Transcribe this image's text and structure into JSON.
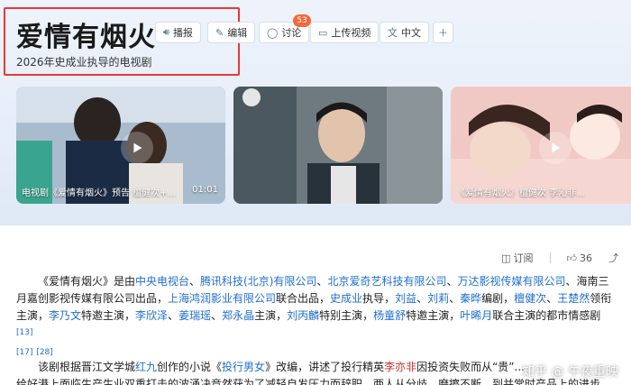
{
  "header": {
    "title": "爱情有烟火",
    "subtitle": "2026年史成业执导的电视剧"
  },
  "actions": {
    "play": "播报",
    "edit": "编辑",
    "discuss": "讨论",
    "discuss_count": "53",
    "upload": "上传视频",
    "lang": "中文"
  },
  "videos": [
    {
      "caption": "电视剧《爱情有烟火》预告 檀健次+...",
      "duration": "01:01"
    },
    {
      "caption": "",
      "duration": ""
    },
    {
      "caption": "《爱情有烟火》檀健次 李沁非...",
      "duration": ""
    }
  ],
  "tools": {
    "subscribe": "订阅",
    "likes": "36"
  },
  "article": {
    "p1": {
      "t1": "《爱情有烟火》是由",
      "l1": "中央电视台",
      "t2": "、",
      "l2": "腾讯科技(北京)有限公司",
      "t3": "、",
      "l3": "北京爱奇艺科技有限公司",
      "t4": "、",
      "l4": "万达影视传媒有限公司",
      "t5": "、海南三月嘉创影视传媒有限公司出品，",
      "l5": "上海鸿润影业有限公司",
      "t6": "联合出品，",
      "l6": "史成业",
      "t7": "执导，",
      "l7": "刘益",
      "t8": "、",
      "l8": "刘莉",
      "t9": "、",
      "l9": "秦晔",
      "t10": "编剧，",
      "l10": "檀健次",
      "t11": "、",
      "l11": "王楚然",
      "t12": "领衔主演，",
      "l12": "李乃文",
      "t13": "特邀主演，",
      "l13": "李欣泽",
      "t14": "、",
      "l14": "姜瑞瑶",
      "t15": "、",
      "l15": "郑永晶",
      "t16": "主演，",
      "l16": "刘丙麟",
      "t17": "特别主演，",
      "l17": "杨童舒",
      "t18": "特邀主演，",
      "l18": "叶晞月",
      "t19": "联合主演的都市情感剧",
      "ref1": "[13]",
      "ref2": "[17]",
      "ref3": "[28]"
    },
    "p2": {
      "t1": "该剧根据晋江文学城",
      "l1": "红九",
      "t2": "创作的小说《",
      "l2": "投行男女",
      "t3": "》改编，讲述了投行精英",
      "r1": "李亦非",
      "t4": "因投资失败而从“贵”...",
      "line2": "给好港上面临生产生业双重打击的波涌决竞然获为了减轻自发压力而辞职，两人从分歧、磨擦不断，到并常时产品上的进步"
    }
  },
  "watermark": "知乎 @ 午夜重映"
}
